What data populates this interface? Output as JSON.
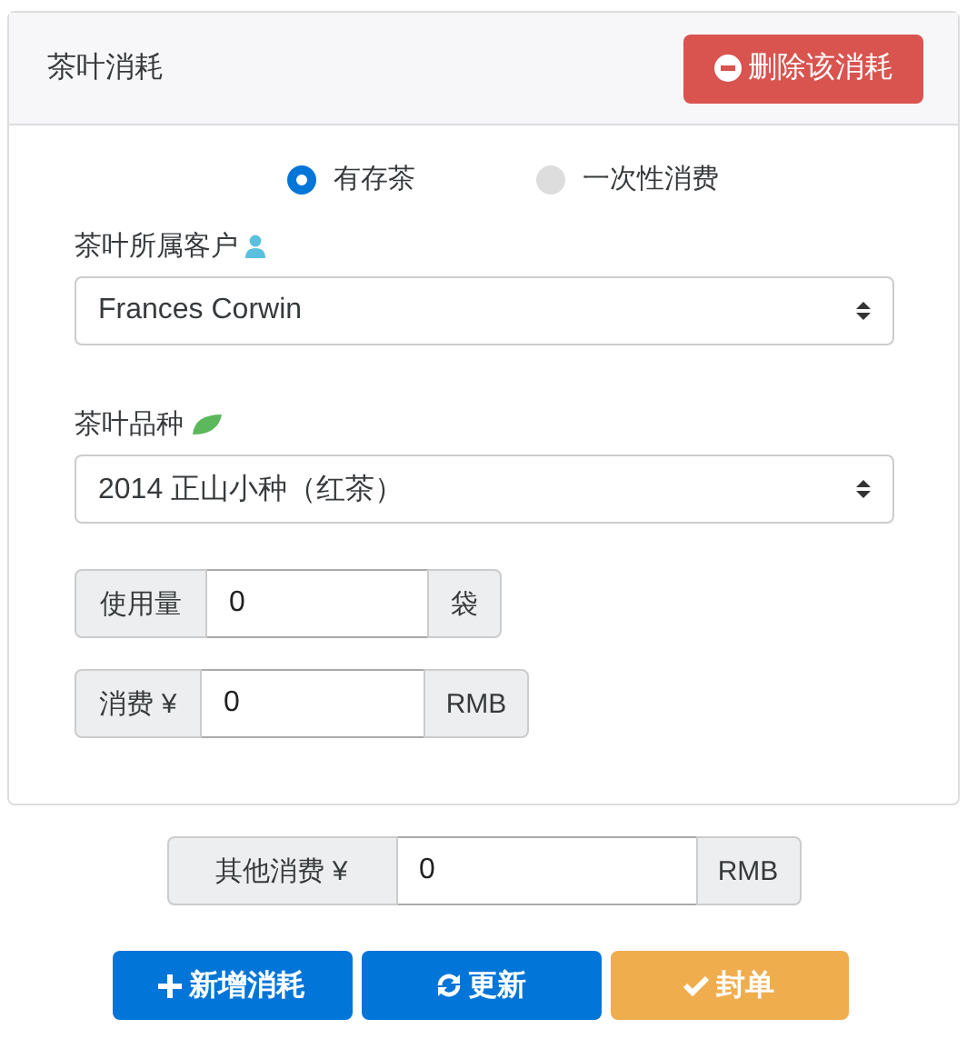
{
  "card": {
    "title": "茶叶消耗",
    "delete_button": "删除该消耗",
    "radios": [
      {
        "label": "有存茶",
        "selected": true
      },
      {
        "label": "一次性消费",
        "selected": false
      }
    ],
    "selects": [
      {
        "label": "茶叶所属客户",
        "value": "Frances Corwin"
      },
      {
        "label": "茶叶品种",
        "value": "2014 正山小种（红茶）"
      }
    ],
    "input_groups": [
      {
        "prefix": "使用量",
        "value": "0",
        "suffix": "袋"
      },
      {
        "prefix": "消费 ¥",
        "value": "0",
        "suffix": "RMB"
      }
    ]
  },
  "other": {
    "prefix": "其他消费 ¥",
    "value": "0",
    "suffix": "RMB"
  },
  "buttons": [
    {
      "label": "新增消耗",
      "kind": "primary"
    },
    {
      "label": "更新",
      "kind": "primary"
    },
    {
      "label": "封单",
      "kind": "warning"
    }
  ]
}
